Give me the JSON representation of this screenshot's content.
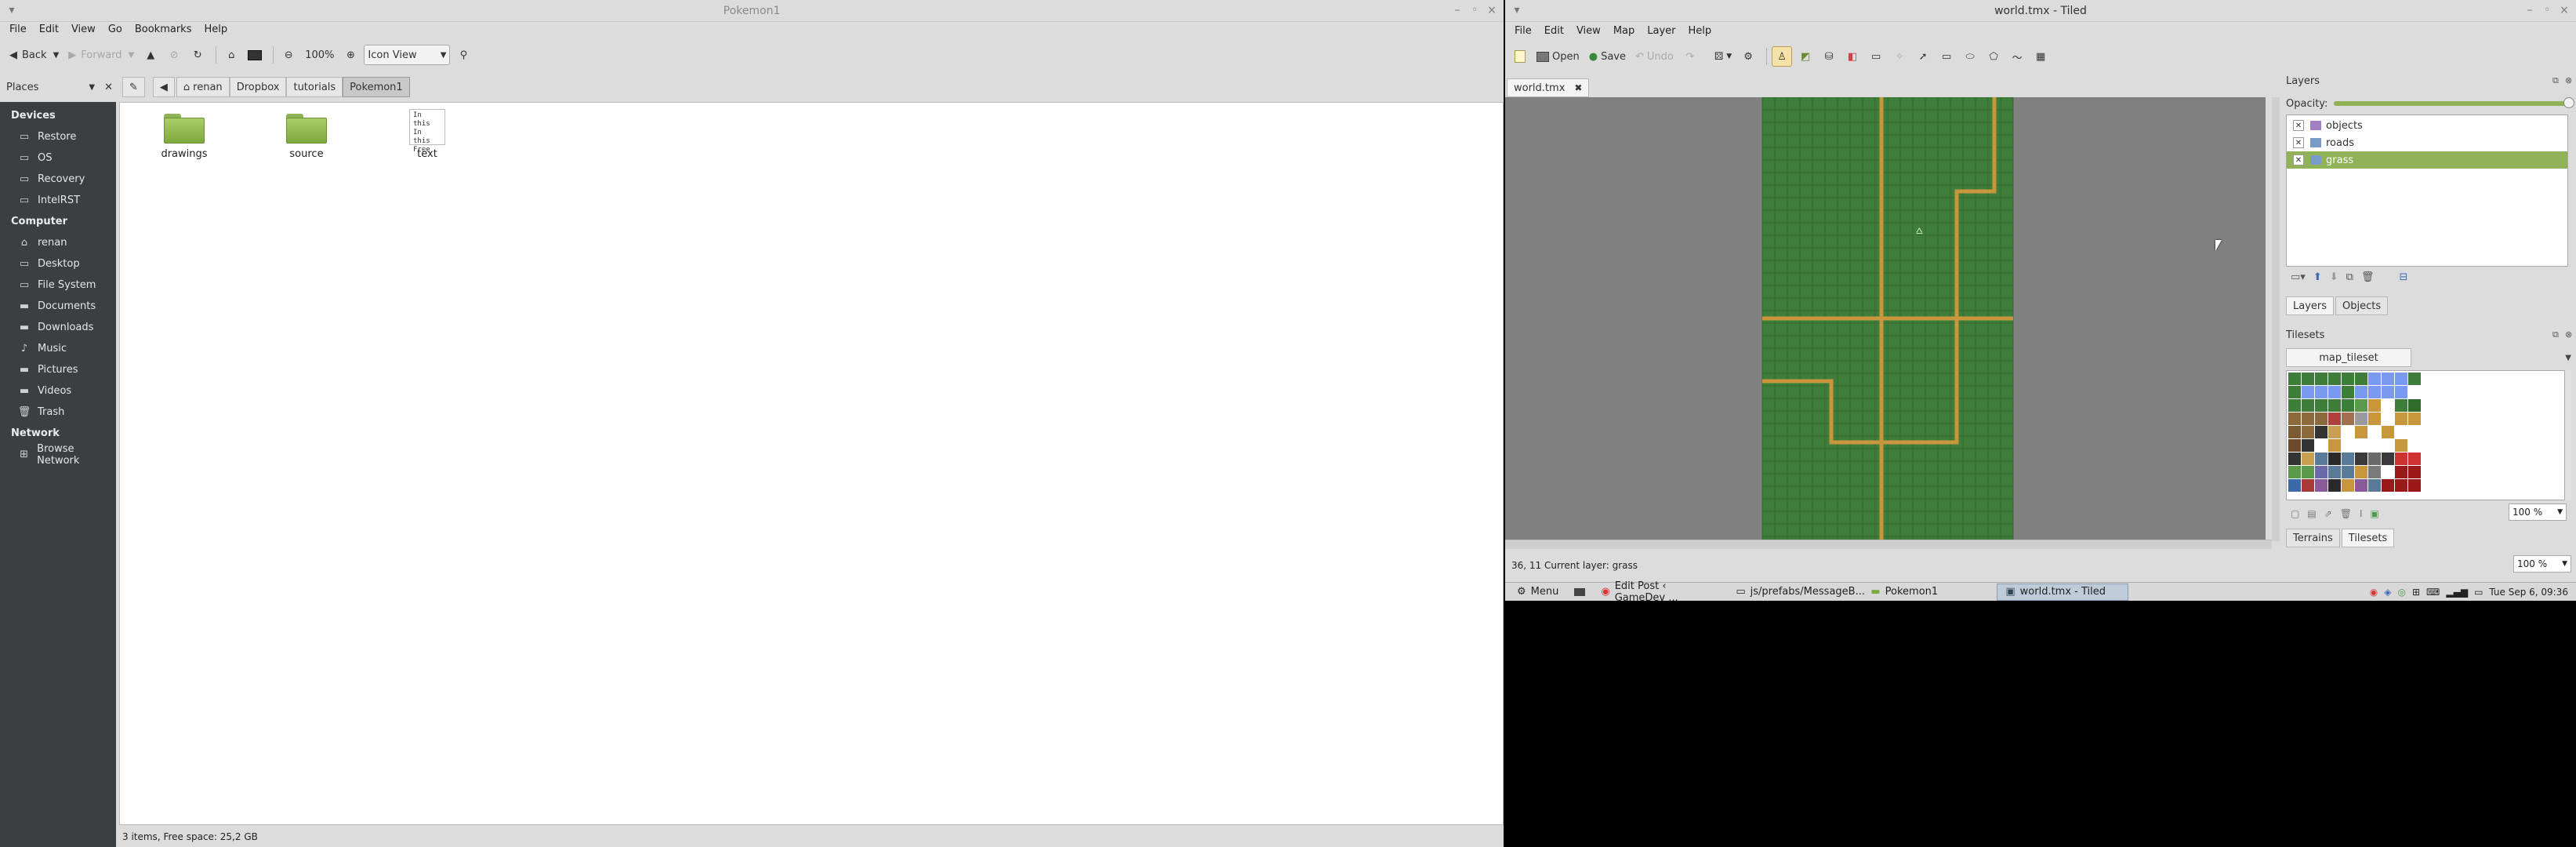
{
  "nemo": {
    "title": "Pokemon1",
    "menu": [
      "File",
      "Edit",
      "View",
      "Go",
      "Bookmarks",
      "Help"
    ],
    "toolbar": {
      "back": "Back",
      "forward": "Forward",
      "zoom": "100%",
      "view_mode": "Icon View"
    },
    "places_label": "Places",
    "breadcrumb": [
      "renan",
      "Dropbox",
      "tutorials",
      "Pokemon1"
    ],
    "sidebar": {
      "sections": [
        {
          "header": "Devices",
          "items": [
            {
              "label": "Restore",
              "icon": "drive-icon"
            },
            {
              "label": "OS",
              "icon": "drive-icon"
            },
            {
              "label": "Recovery",
              "icon": "drive-icon"
            },
            {
              "label": "IntelRST",
              "icon": "drive-icon"
            }
          ]
        },
        {
          "header": "Computer",
          "items": [
            {
              "label": "renan",
              "icon": "home-icon"
            },
            {
              "label": "Desktop",
              "icon": "desktop-icon"
            },
            {
              "label": "File System",
              "icon": "drive-icon"
            },
            {
              "label": "Documents",
              "icon": "folder-icon"
            },
            {
              "label": "Downloads",
              "icon": "folder-icon"
            },
            {
              "label": "Music",
              "icon": "music-icon"
            },
            {
              "label": "Pictures",
              "icon": "folder-icon"
            },
            {
              "label": "Videos",
              "icon": "folder-icon"
            },
            {
              "label": "Trash",
              "icon": "trash-icon"
            }
          ]
        },
        {
          "header": "Network",
          "items": [
            {
              "label": "Browse Network",
              "icon": "network-icon"
            }
          ]
        }
      ]
    },
    "files": [
      {
        "name": "drawings",
        "type": "folder"
      },
      {
        "name": "source",
        "type": "folder"
      },
      {
        "name": "text",
        "type": "text",
        "preview": [
          "In this",
          "",
          "In this",
          "  Free"
        ]
      }
    ],
    "status": "3 items, Free space: 25,2 GB"
  },
  "tiled": {
    "title": "world.tmx - Tiled",
    "menu": [
      "File",
      "Edit",
      "View",
      "Map",
      "Layer",
      "Help"
    ],
    "toolbar": {
      "open": "Open",
      "save": "Save",
      "undo": "Undo"
    },
    "doc_tab": "world.tmx",
    "layers_panel": {
      "title": "Layers",
      "opacity_label": "Opacity:",
      "layers": [
        {
          "name": "objects",
          "selected": false
        },
        {
          "name": "roads",
          "selected": false
        },
        {
          "name": "grass",
          "selected": true
        }
      ],
      "tabs": [
        "Layers",
        "Objects"
      ]
    },
    "tilesets_panel": {
      "title": "Tilesets",
      "tileset_tab": "map_tileset",
      "zoom": "100 %",
      "tabs": [
        "Terrains",
        "Tilesets"
      ]
    },
    "map_zoom": "100 %",
    "status": "36, 11  Current layer: grass",
    "colors": {
      "grass": "#3f7d3a",
      "road": "#c8963c",
      "selection": "#8fb356"
    }
  },
  "taskbar": {
    "menu": "Menu",
    "tasks": [
      {
        "label": "Edit Post ‹ GameDev ...",
        "active": false,
        "icon": "chrome-icon"
      },
      {
        "label": "js/prefabs/MessageB...",
        "active": false,
        "icon": "editor-icon"
      },
      {
        "label": "Pokemon1",
        "active": false,
        "icon": "folder-icon"
      },
      {
        "label": "world.tmx - Tiled",
        "active": true,
        "icon": "tiled-icon"
      }
    ],
    "clock": "Tue Sep 6, 09:36"
  }
}
